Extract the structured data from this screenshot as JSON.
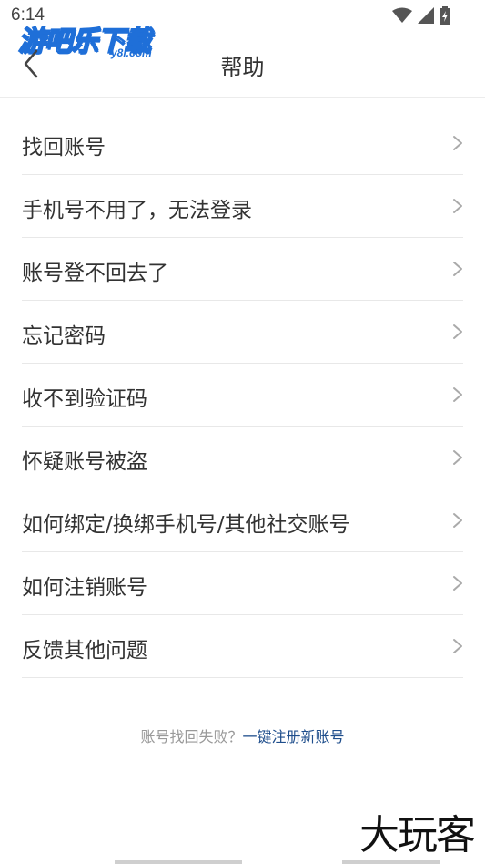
{
  "status_bar": {
    "time": "6:14",
    "icons": [
      "wifi-icon",
      "cell-signal-icon",
      "battery-icon"
    ]
  },
  "watermark": {
    "logo_text": "游吧乐下载",
    "logo_sub": "y8l.com",
    "bottom_text": "大玩客"
  },
  "header": {
    "title": "帮助",
    "back_icon": "chevron-left-icon"
  },
  "help_items": [
    {
      "label": "找回账号"
    },
    {
      "label": "手机号不用了，无法登录"
    },
    {
      "label": "账号登不回去了"
    },
    {
      "label": "忘记密码"
    },
    {
      "label": "收不到验证码"
    },
    {
      "label": "怀疑账号被盗"
    },
    {
      "label": "如何绑定/换绑手机号/其他社交账号"
    },
    {
      "label": "如何注销账号"
    },
    {
      "label": "反馈其他问题"
    }
  ],
  "footer": {
    "text": "账号找回失败？",
    "link": "一键注册新账号"
  },
  "colors": {
    "link": "#1f4e8c",
    "logo_blue": "#1f6fd8",
    "divider": "#e8e8e8",
    "muted": "#999999"
  }
}
